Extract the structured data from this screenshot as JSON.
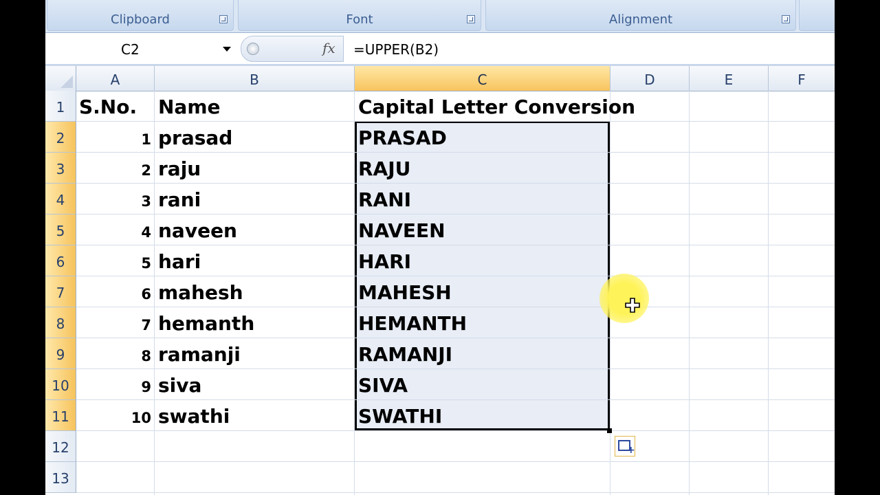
{
  "ribbon": {
    "groups": [
      {
        "label": "Clipboard"
      },
      {
        "label": "Font"
      },
      {
        "label": "Alignment"
      }
    ]
  },
  "formula_bar": {
    "name_box": "C2",
    "fx_label": "fx",
    "formula": "=UPPER(B2)"
  },
  "columns": [
    "A",
    "B",
    "C",
    "D",
    "E",
    "F"
  ],
  "selected_column": "C",
  "rows": [
    "1",
    "2",
    "3",
    "4",
    "5",
    "6",
    "7",
    "8",
    "9",
    "10",
    "11",
    "12",
    "13"
  ],
  "header_row": {
    "a": "S.No.",
    "b": "Name",
    "c": "Capital Letter Conversion"
  },
  "data_rows": [
    {
      "sno": "1",
      "name": "prasad",
      "upper": "PRASAD"
    },
    {
      "sno": "2",
      "name": "raju",
      "upper": "RAJU"
    },
    {
      "sno": "3",
      "name": "rani",
      "upper": "RANI"
    },
    {
      "sno": "4",
      "name": "naveen",
      "upper": "NAVEEN"
    },
    {
      "sno": "5",
      "name": "hari",
      "upper": "HARI"
    },
    {
      "sno": "6",
      "name": "mahesh",
      "upper": "MAHESH"
    },
    {
      "sno": "7",
      "name": "hemanth",
      "upper": "HEMANTH"
    },
    {
      "sno": "8",
      "name": "ramanji",
      "upper": "RAMANJI"
    },
    {
      "sno": "9",
      "name": "siva",
      "upper": "SIVA"
    },
    {
      "sno": "10",
      "name": "swathi",
      "upper": "SWATHI"
    }
  ],
  "icons": {
    "cursor": "move-cross-cursor",
    "autofill": "auto-fill-options-icon"
  },
  "colors": {
    "selection_header": "#f8c45e",
    "selection_fill": "#e8edf6",
    "cursor_highlight": "#fff35a"
  }
}
